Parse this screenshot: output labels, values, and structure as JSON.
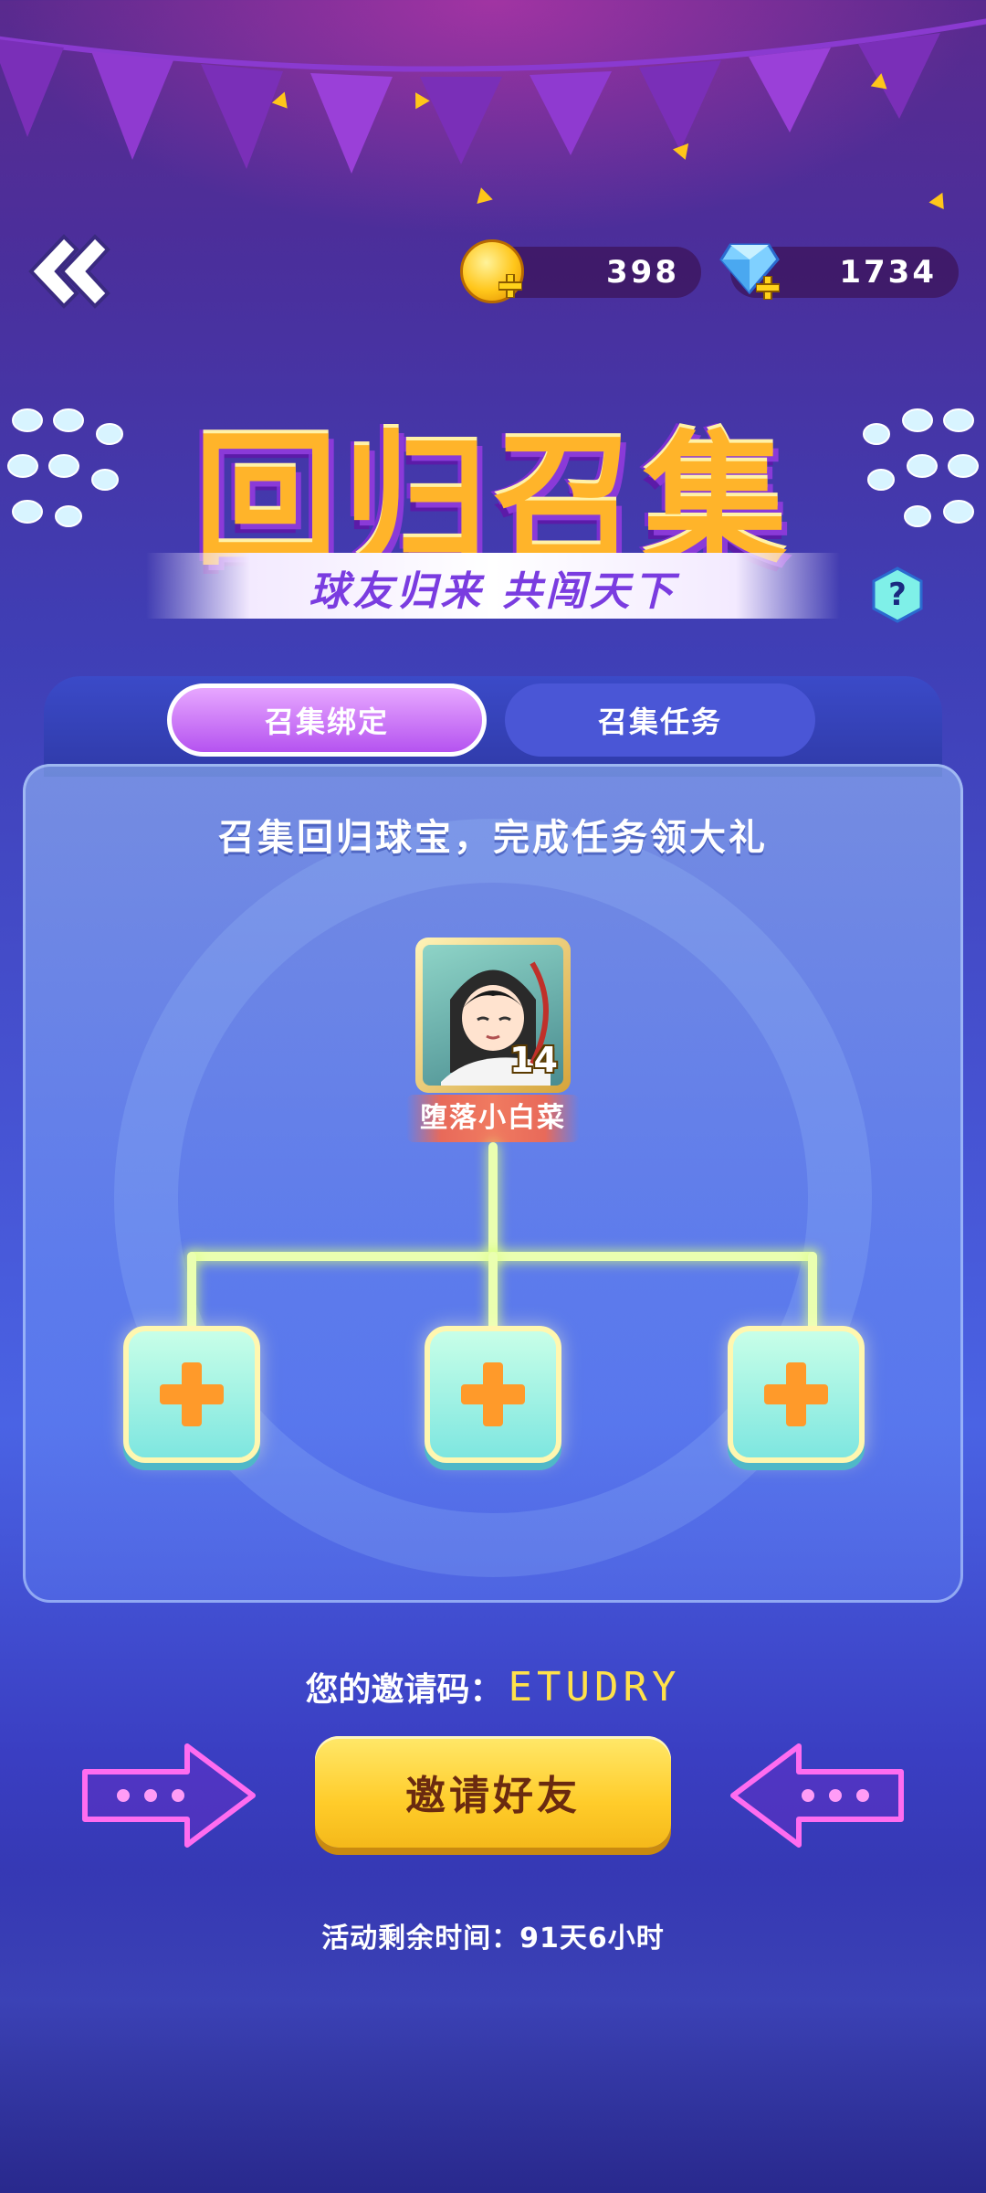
{
  "header": {
    "coins": "398",
    "gems": "1734"
  },
  "title": {
    "main": "回归召集",
    "subtitle": "球友归来  共闯天下",
    "help": "?"
  },
  "tabs": [
    {
      "label": "召集绑定",
      "active": true
    },
    {
      "label": "召集任务",
      "active": false
    }
  ],
  "panel": {
    "heading": "召集回归球宝，完成任务领大礼",
    "player": {
      "name": "堕落小白菜",
      "level": "14"
    },
    "slots": 3
  },
  "invite": {
    "label": "您的邀请码：",
    "code": "ETUDRY",
    "button": "邀请好友"
  },
  "timer": "活动剩余时间：91天6小时",
  "colors": {
    "accent_gold": "#ffcc2a",
    "tab_active": "#b553f0",
    "tab_inactive": "#4a56d6",
    "title_orange": "#ffb42a",
    "neon_pink": "#ff6cf0"
  },
  "icons": [
    "back-chevron-icon",
    "coin-icon",
    "gem-icon",
    "help-icon",
    "plus-icon",
    "arrow-right-icon",
    "arrow-left-icon"
  ]
}
